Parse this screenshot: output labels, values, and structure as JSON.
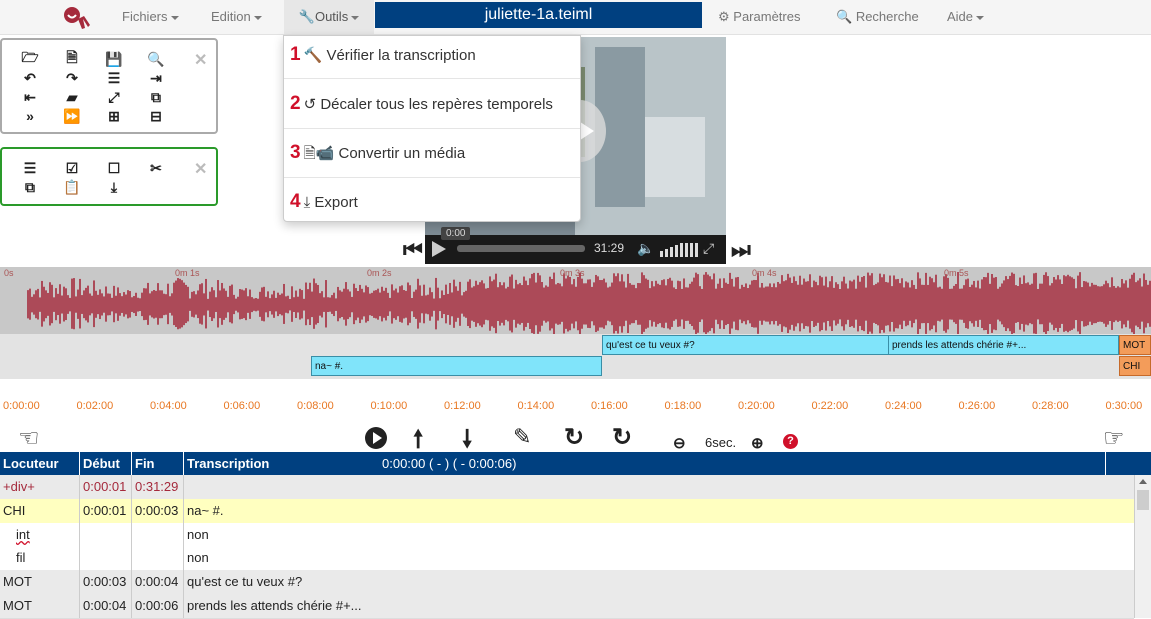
{
  "menubar": {
    "fichiers": "Fichiers",
    "edition": "Edition",
    "outils": "Outils",
    "filename": "juliette-1a.teiml",
    "parametres": "Paramètres",
    "recherche": "Recherche",
    "aide": "Aide"
  },
  "tools_menu": {
    "items": [
      {
        "num": "1",
        "label": "Vérifier la transcription",
        "icon": "hammer-icon"
      },
      {
        "num": "2",
        "label": "Décaler tous les repères temporels",
        "icon": "history-icon"
      },
      {
        "num": "3",
        "label": "Convertir un média",
        "icon": "audio-video-file-icon"
      },
      {
        "num": "4",
        "label": "Export",
        "icon": "download-icon"
      }
    ]
  },
  "video": {
    "current_time": "0:00",
    "duration": "31:29",
    "progress": 0.0
  },
  "waveform": {
    "time_labels": [
      "0s",
      "0m 1s",
      "0m 2s",
      "0m 3s",
      "0m 4s",
      "0m 5s"
    ],
    "color": "#a52a3c"
  },
  "segments": [
    {
      "text": "na~ #.",
      "speaker": "CHI"
    },
    {
      "text": "qu'est ce tu veux #?",
      "speaker": "MOT"
    },
    {
      "text": "prends les attends chérie #+...",
      "speaker": "MOT"
    },
    {
      "text": "MOT",
      "speaker": "MOT"
    },
    {
      "text": "CHI",
      "speaker": "CHI"
    }
  ],
  "ruler": {
    "labels": [
      "0:00:00",
      "0:02:00",
      "0:04:00",
      "0:06:00",
      "0:08:00",
      "0:10:00",
      "0:12:00",
      "0:14:00",
      "0:16:00",
      "0:18:00",
      "0:20:00",
      "0:22:00",
      "0:24:00",
      "0:26:00",
      "0:28:00",
      "0:30:00"
    ]
  },
  "playback": {
    "zoom_label": "6sec."
  },
  "table": {
    "headers": {
      "locuteur": "Locuteur",
      "debut": "Début",
      "fin": "Fin",
      "transcription": "Transcription",
      "timeinfo": "0:00:00 ( - )  ( - 0:00:06)"
    },
    "rows": [
      {
        "loc": "+div+",
        "debut": "0:00:01",
        "fin": "0:31:29",
        "text": ""
      },
      {
        "loc": "CHI",
        "debut": "0:00:01",
        "fin": "0:00:03",
        "text": "na~ #."
      },
      {
        "loc": "int",
        "debut": "",
        "fin": "",
        "text": "non"
      },
      {
        "loc": "fil",
        "debut": "",
        "fin": "",
        "text": "non"
      },
      {
        "loc": "MOT",
        "debut": "0:00:03",
        "fin": "0:00:04",
        "text": "qu'est ce tu veux #?"
      },
      {
        "loc": "MOT",
        "debut": "0:00:04",
        "fin": "0:00:06",
        "text": "prends les attends chérie #+..."
      }
    ]
  },
  "colors": {
    "navy": "#004080",
    "accent_red": "#d0102a",
    "segment_blue": "#80e4fa",
    "segment_orange": "#f39c5a",
    "highlight_row": "#ffffc0"
  }
}
